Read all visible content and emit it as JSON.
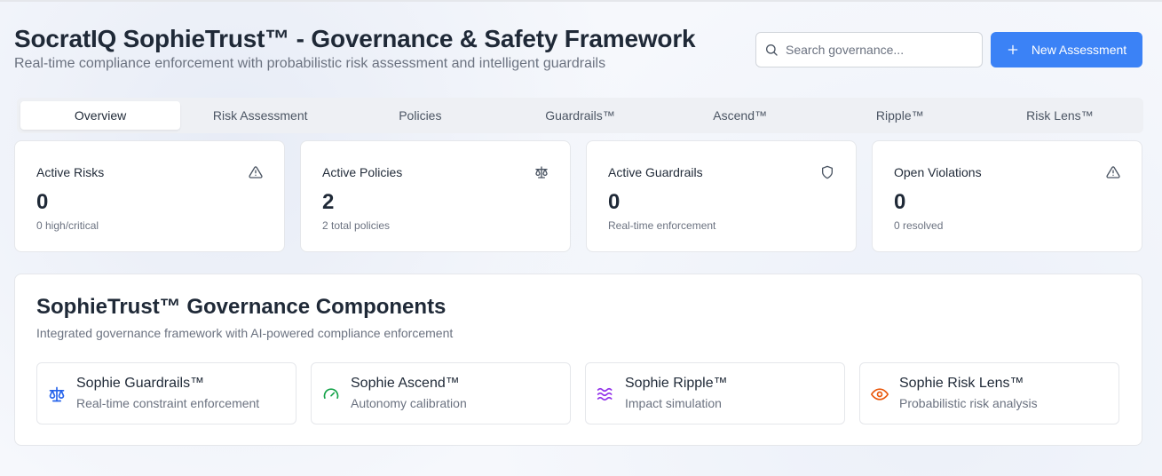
{
  "header": {
    "title": "SocratIQ SophieTrust™ - Governance & Safety Framework",
    "subtitle": "Real-time compliance enforcement with probabilistic risk assessment and intelligent guardrails",
    "search_placeholder": "Search governance...",
    "new_assessment_label": "New Assessment"
  },
  "tabs": [
    {
      "label": "Overview",
      "active": true
    },
    {
      "label": "Risk Assessment"
    },
    {
      "label": "Policies"
    },
    {
      "label": "Guardrails™"
    },
    {
      "label": "Ascend™"
    },
    {
      "label": "Ripple™"
    },
    {
      "label": "Risk Lens™"
    }
  ],
  "stats": [
    {
      "label": "Active Risks",
      "value": "0",
      "sub": "0 high/critical",
      "icon": "alert-triangle-icon"
    },
    {
      "label": "Active Policies",
      "value": "2",
      "sub": "2 total policies",
      "icon": "scale-icon"
    },
    {
      "label": "Active Guardrails",
      "value": "0",
      "sub": "Real-time enforcement",
      "icon": "shield-icon"
    },
    {
      "label": "Open Violations",
      "value": "0",
      "sub": "0 resolved",
      "icon": "alert-triangle-icon"
    }
  ],
  "components": {
    "title": "SophieTrust™ Governance Components",
    "subtitle": "Integrated governance framework with AI-powered compliance enforcement",
    "items": [
      {
        "name": "Sophie Guardrails™",
        "desc": "Real-time constraint enforcement",
        "icon": "scale-icon",
        "color": "#2563eb"
      },
      {
        "name": "Sophie Ascend™",
        "desc": "Autonomy calibration",
        "icon": "gauge-icon",
        "color": "#16a34a"
      },
      {
        "name": "Sophie Ripple™",
        "desc": "Impact simulation",
        "icon": "waves-icon",
        "color": "#9333ea"
      },
      {
        "name": "Sophie Risk Lens™",
        "desc": "Probabilistic risk analysis",
        "icon": "eye-icon",
        "color": "#ea580c"
      }
    ]
  },
  "colors": {
    "primary": "#3b82f6",
    "text": "#1f2937",
    "muted": "#6b7280",
    "border": "#e5e7eb"
  }
}
